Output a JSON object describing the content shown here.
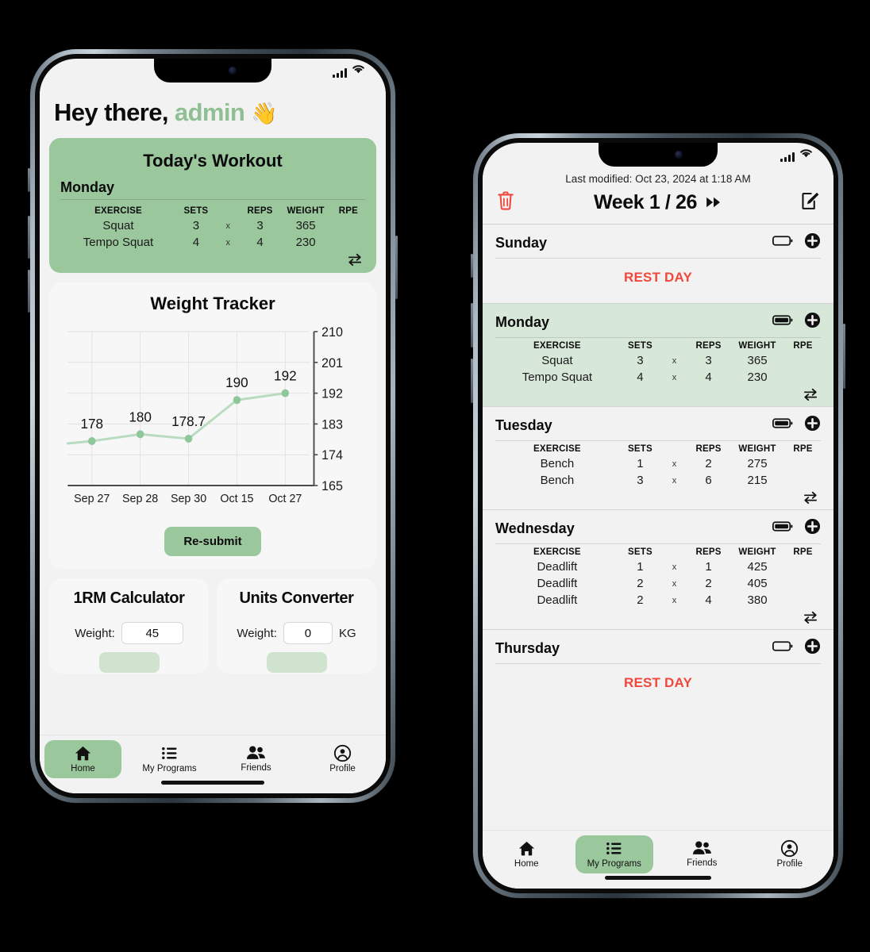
{
  "theme": {
    "accent_green": "#9bc79d",
    "highlight_green": "#d7e8d8",
    "rest_red": "#f0483c",
    "screen_bg": "#f2f2f2",
    "card_bg": "#f7f7f7",
    "chart_line": "#b9dcc0"
  },
  "phone1": {
    "status_bar": {
      "signal_icon": "signal-bars-icon",
      "wifi_icon": "wifi-icon"
    },
    "greeting": {
      "prefix": "Hey there,",
      "user": "admin",
      "wave": "👋"
    },
    "todays_workout": {
      "title": "Today's Workout",
      "day": "Monday",
      "columns": [
        "EXERCISE",
        "SETS",
        "REPS",
        "WEIGHT",
        "RPE"
      ],
      "multiplier": "x",
      "rows": [
        {
          "exercise": "Squat",
          "sets": "3",
          "reps": "3",
          "weight": "365",
          "rpe": ""
        },
        {
          "exercise": "Tempo Squat",
          "sets": "4",
          "reps": "4",
          "weight": "230",
          "rpe": ""
        }
      ],
      "swap_icon": "swap-arrows-icon"
    },
    "weight_tracker": {
      "title": "Weight Tracker",
      "resubmit_label": "Re-submit"
    },
    "calculator_card": {
      "title": "1RM Calculator",
      "weight_label": "Weight:",
      "weight_value": "45"
    },
    "converter_card": {
      "title": "Units Converter",
      "weight_label": "Weight:",
      "weight_value": "0",
      "unit": "KG"
    },
    "tabs": [
      {
        "label": "Home",
        "icon": "home-icon",
        "active": true
      },
      {
        "label": "My Programs",
        "icon": "list-icon",
        "active": false
      },
      {
        "label": "Friends",
        "icon": "people-icon",
        "active": false
      },
      {
        "label": "Profile",
        "icon": "account-circle-icon",
        "active": false
      }
    ]
  },
  "phone2": {
    "status_bar": {
      "signal_icon": "signal-bars-icon",
      "wifi_icon": "wifi-icon"
    },
    "last_modified": "Last modified: Oct 23, 2024 at 1:18 AM",
    "header": {
      "delete_icon": "trash-icon",
      "title": "Week 1 / 26",
      "next_icon": "fast-forward-icon",
      "edit_icon": "edit-square-pencil-icon"
    },
    "columns": [
      "EXERCISE",
      "SETS",
      "REPS",
      "WEIGHT",
      "RPE"
    ],
    "multiplier": "x",
    "rest_label": "REST DAY",
    "days": [
      {
        "name": "Sunday",
        "rest": true,
        "highlight": false,
        "battery_icon": "battery-empty-icon",
        "add_icon": "plus-circle-icon",
        "rows": []
      },
      {
        "name": "Monday",
        "rest": false,
        "highlight": true,
        "battery_icon": "battery-full-icon",
        "add_icon": "plus-circle-icon",
        "swap_icon": "swap-arrows-icon",
        "rows": [
          {
            "exercise": "Squat",
            "sets": "3",
            "reps": "3",
            "weight": "365",
            "rpe": ""
          },
          {
            "exercise": "Tempo Squat",
            "sets": "4",
            "reps": "4",
            "weight": "230",
            "rpe": ""
          }
        ]
      },
      {
        "name": "Tuesday",
        "rest": false,
        "highlight": false,
        "battery_icon": "battery-full-icon",
        "add_icon": "plus-circle-icon",
        "swap_icon": "swap-arrows-icon",
        "rows": [
          {
            "exercise": "Bench",
            "sets": "1",
            "reps": "2",
            "weight": "275",
            "rpe": ""
          },
          {
            "exercise": "Bench",
            "sets": "3",
            "reps": "6",
            "weight": "215",
            "rpe": ""
          }
        ]
      },
      {
        "name": "Wednesday",
        "rest": false,
        "highlight": false,
        "battery_icon": "battery-full-icon",
        "add_icon": "plus-circle-icon",
        "swap_icon": "swap-arrows-icon",
        "rows": [
          {
            "exercise": "Deadlift",
            "sets": "1",
            "reps": "1",
            "weight": "425",
            "rpe": ""
          },
          {
            "exercise": "Deadlift",
            "sets": "2",
            "reps": "2",
            "weight": "405",
            "rpe": ""
          },
          {
            "exercise": "Deadlift",
            "sets": "2",
            "reps": "4",
            "weight": "380",
            "rpe": ""
          }
        ]
      },
      {
        "name": "Thursday",
        "rest": true,
        "highlight": false,
        "battery_icon": "battery-empty-icon",
        "add_icon": "plus-circle-icon",
        "rows": []
      }
    ],
    "tabs": [
      {
        "label": "Home",
        "icon": "home-icon",
        "active": false
      },
      {
        "label": "My Programs",
        "icon": "list-icon",
        "active": true
      },
      {
        "label": "Friends",
        "icon": "people-icon",
        "active": false
      },
      {
        "label": "Profile",
        "icon": "account-circle-icon",
        "active": false
      }
    ]
  },
  "chart_data": {
    "type": "line",
    "title": "Weight Tracker",
    "xlabel": "",
    "ylabel": "",
    "categories": [
      "Sep 27",
      "Sep 28",
      "Sep 30",
      "Oct 15",
      "Oct 27"
    ],
    "values": [
      178,
      180,
      178.7,
      190,
      192
    ],
    "point_labels": [
      "178",
      "180",
      "178.7",
      "190",
      "192"
    ],
    "ylim": [
      165,
      210
    ],
    "yticks": [
      165,
      174,
      183,
      192,
      201,
      210
    ],
    "ytick_labels": [
      "165",
      "174",
      "183",
      "192",
      "201",
      "210"
    ],
    "y_axis_position": "right",
    "grid": true,
    "legend": false,
    "line_color": "#b9dcc0",
    "marker_color": "#8fc79a"
  }
}
